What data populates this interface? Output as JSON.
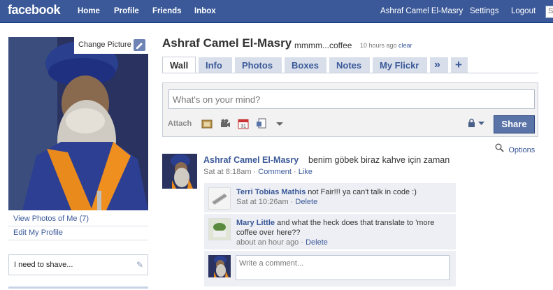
{
  "topbar": {
    "logo": "facebook",
    "nav": [
      "Home",
      "Profile",
      "Friends",
      "Inbox"
    ],
    "user_name": "Ashraf Camel El-Masry",
    "settings": "Settings",
    "logout": "Logout",
    "search_placeholder": "S"
  },
  "left": {
    "change_picture": "Change Picture",
    "view_photos": "View Photos of Me (7)",
    "edit_profile": "Edit My Profile",
    "status_box": "I need to shave..."
  },
  "header": {
    "name": "Ashraf Camel El-Masry",
    "status": "mmmm...coffee",
    "time": "10 hours ago",
    "clear": "clear"
  },
  "tabs": [
    "Wall",
    "Info",
    "Photos",
    "Boxes",
    "Notes",
    "My Flickr"
  ],
  "tab_more": "»",
  "tab_add": "+",
  "composer": {
    "placeholder": "What's on your mind?",
    "attach_label": "Attach",
    "share": "Share"
  },
  "options_label": "Options",
  "post": {
    "author": "Ashraf Camel El-Masry",
    "text": "benim göbek biraz kahve için zaman",
    "time": "Sat at 8:18am",
    "comment_link": "Comment",
    "like_link": "Like"
  },
  "comments": [
    {
      "author": "Terri Tobias Mathis",
      "text": "not Fair!!! ya can't talk in code :)",
      "time": "Sat at 10:26am",
      "delete": "Delete"
    },
    {
      "author": "Mary Little",
      "text": "and what the heck does that translate to 'more coffee over here??",
      "time": "about an hour ago",
      "delete": "Delete"
    }
  ],
  "comment_placeholder": "Write a comment...",
  "colors": {
    "brand": "#3b5998",
    "tab_bg": "#d8dfea",
    "comment_bg": "#edeff4"
  }
}
